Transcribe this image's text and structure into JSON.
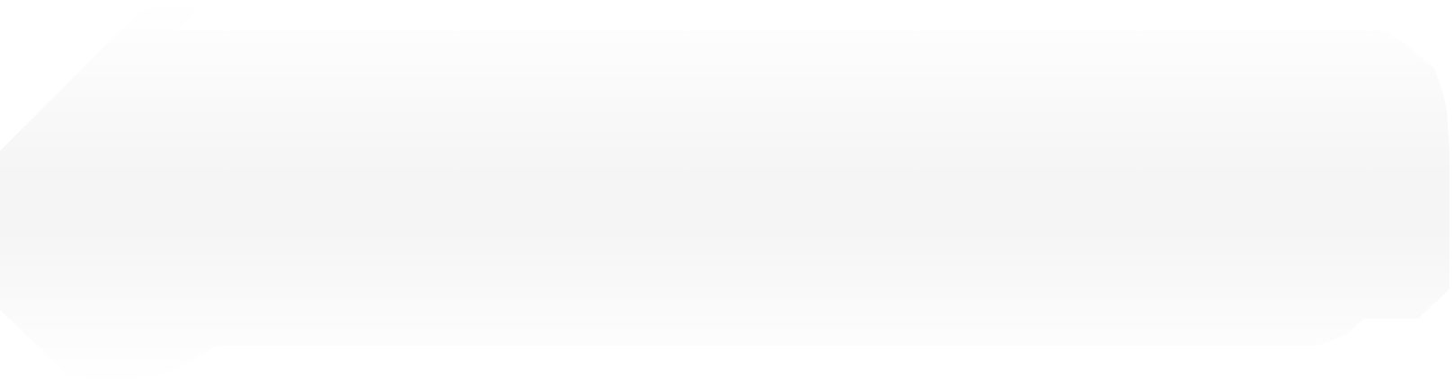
{
  "panel": {
    "colors": {
      "page_background": "#ffffff",
      "fill_edge": "#ffffff",
      "fill_center": "#f5f5f5"
    }
  }
}
